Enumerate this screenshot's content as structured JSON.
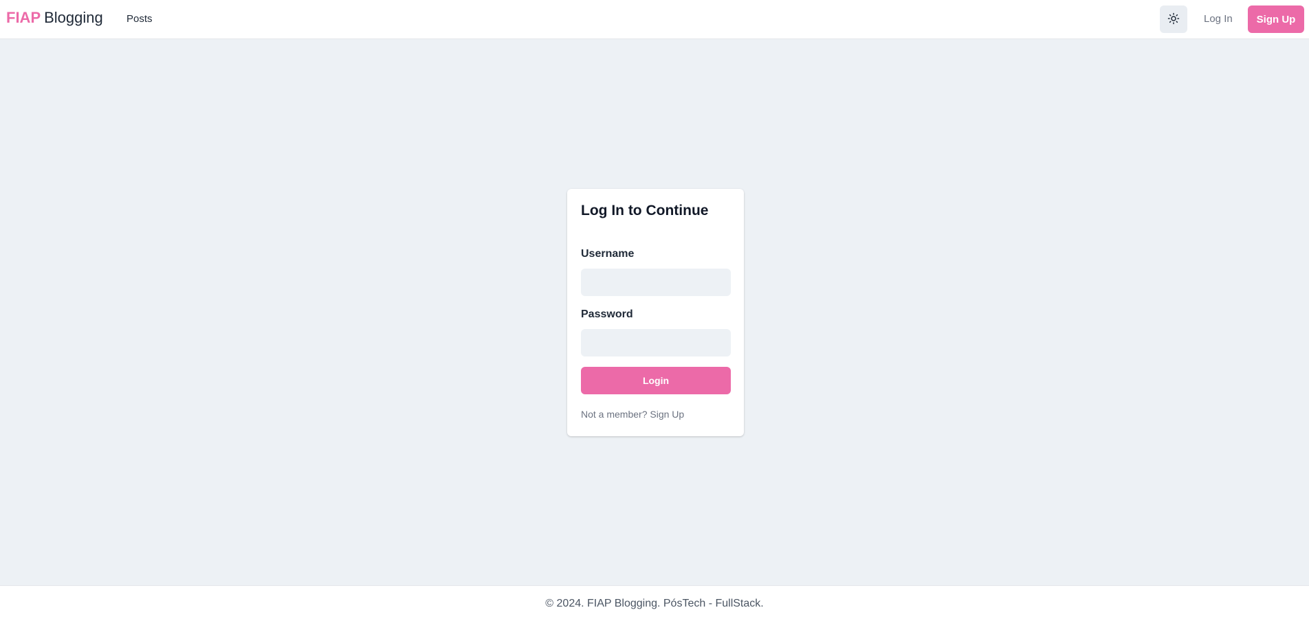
{
  "header": {
    "brand_primary": "FIAP",
    "brand_secondary": "Blogging",
    "nav": {
      "posts": "Posts"
    },
    "theme_toggle_icon": "sun-icon",
    "login_label": "Log In",
    "signup_label": "Sign Up"
  },
  "login_card": {
    "title": "Log In to Continue",
    "username_label": "Username",
    "username_value": "",
    "password_label": "Password",
    "password_value": "",
    "submit_label": "Login",
    "member_prompt": "Not a member?",
    "member_link": "Sign Up"
  },
  "footer": {
    "text": "© 2024. FIAP Blogging. PósTech - FullStack."
  },
  "colors": {
    "accent": "#ec6aa8",
    "background": "#edf1f5",
    "surface": "#ffffff"
  }
}
